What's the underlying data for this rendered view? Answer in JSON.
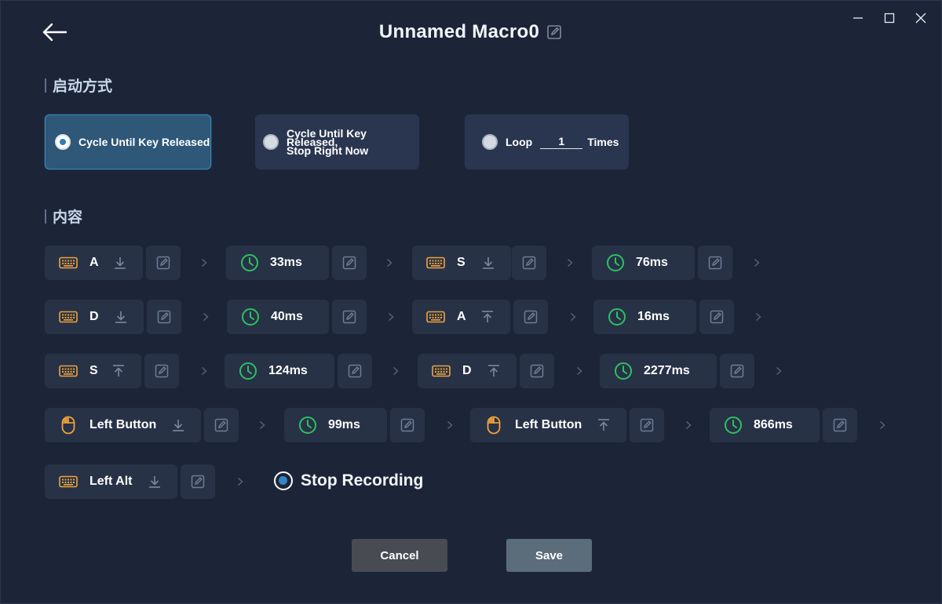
{
  "window": {
    "minimize": "minimize",
    "maximize": "maximize",
    "close": "close"
  },
  "header": {
    "title": "Unnamed Macro0"
  },
  "start_mode": {
    "heading": "启动方式",
    "options": [
      {
        "label": "Cycle Until Key Released",
        "selected": true
      },
      {
        "label_line1": "Cycle Until Key Released,",
        "label_line2": "Stop Right Now",
        "selected": false
      },
      {
        "prefix": "Loop",
        "value": "1",
        "suffix": "Times",
        "selected": false
      }
    ]
  },
  "content": {
    "heading": "内容",
    "rows": [
      [
        {
          "type": "key",
          "label": "A",
          "action": "down"
        },
        {
          "type": "delay",
          "label": "33ms"
        },
        {
          "type": "key",
          "label": "S",
          "action": "down"
        },
        {
          "type": "delay",
          "label": "76ms"
        }
      ],
      [
        {
          "type": "key",
          "label": "D",
          "action": "down"
        },
        {
          "type": "delay",
          "label": "40ms"
        },
        {
          "type": "key",
          "label": "A",
          "action": "up"
        },
        {
          "type": "delay",
          "label": "16ms"
        }
      ],
      [
        {
          "type": "key",
          "label": "S",
          "action": "up"
        },
        {
          "type": "delay",
          "label": "124ms"
        },
        {
          "type": "key",
          "label": "D",
          "action": "up"
        },
        {
          "type": "delay",
          "label": "2277ms"
        }
      ],
      [
        {
          "type": "mouse",
          "label": "Left Button",
          "action": "down"
        },
        {
          "type": "delay",
          "label": "99ms"
        },
        {
          "type": "mouse",
          "label": "Left Button",
          "action": "up"
        },
        {
          "type": "delay",
          "label": "866ms"
        }
      ],
      [
        {
          "type": "key",
          "label": "Left Alt",
          "action": "down"
        }
      ]
    ],
    "stop_recording": "Stop Recording"
  },
  "footer": {
    "cancel": "Cancel",
    "save": "Save"
  },
  "colors": {
    "background": "#1c2538",
    "chip": "#273247",
    "key_icon": "#f0a23a",
    "delay_icon": "#2fbf62",
    "accent": "#3485c4"
  }
}
